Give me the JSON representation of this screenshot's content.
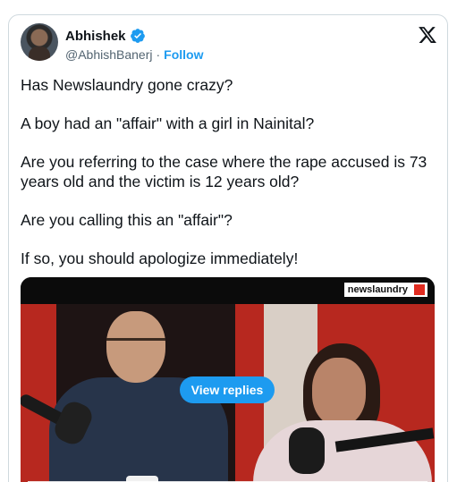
{
  "tweet": {
    "author": {
      "name": "Abhishek",
      "handle": "@AbhishBanerj",
      "separator": "·",
      "follow_label": "Follow",
      "verified": true
    },
    "text": [
      "Has Newslaundry gone crazy?",
      "A boy had an \"affair\" with a girl in Nainital?",
      "Are you referring to the case where the rape accused is 73 years old and the victim is 12 years old?",
      "Are you calling this an \"affair\"?",
      "If so, you should apologize immediately!"
    ],
    "media": {
      "watermark": "newslaundry",
      "view_replies_label": "View replies"
    }
  },
  "colors": {
    "accent": "#1d9bf0",
    "text": "#0f1419",
    "secondary_text": "#536471",
    "border": "#cfd9de"
  },
  "icons": {
    "verified": "verified-badge-icon",
    "platform": "x-logo-icon"
  }
}
